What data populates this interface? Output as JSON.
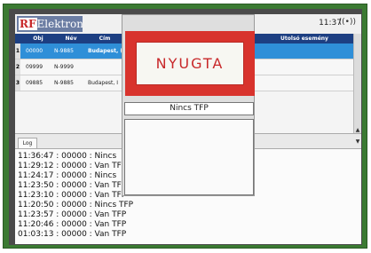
{
  "header": {
    "logo_text": "RF Elektronik",
    "logo_rf": "RF",
    "logo_rest": "Elektronik",
    "time": "11:37",
    "wifi_symbol": "((•))"
  },
  "table": {
    "columns": [
      "Obj",
      "Név",
      "Cím",
      "Utolsó esemény"
    ],
    "rows": [
      {
        "idx": "1",
        "obj": "00000",
        "nev": "N-9885",
        "cim": "Budapest, (",
        "selected": true
      },
      {
        "idx": "2",
        "obj": "09999",
        "nev": "N-9999",
        "cim": "",
        "selected": false
      },
      {
        "idx": "3",
        "obj": "09885",
        "nev": "N-9885",
        "cim": "Budapest, I",
        "selected": false
      }
    ]
  },
  "log": {
    "tab_label": "Log",
    "lines": [
      "11:36:47 : 00000 : Nincs",
      "11:29:12 : 00000 : Van TF",
      "11:24:17 : 00000 : Nincs",
      "11:23:50 : 00000 : Van TF",
      "11:23:10 : 00000 : Van TFF",
      "11:20:50 : 00000 : Nincs TFP",
      "11:23:57 : 00000 : Van TFP",
      "11:20:46 : 00000 : Van TFP",
      "01:03:13 : 00000 : Van TFP"
    ]
  },
  "popup": {
    "banner": "NYUGTA",
    "status": "Nincs TFP"
  },
  "colors": {
    "frame": "#3b7a32",
    "header_bg": "#1d3f82",
    "selected_row": "#2f8fd8",
    "banner_red": "#d8332d"
  }
}
